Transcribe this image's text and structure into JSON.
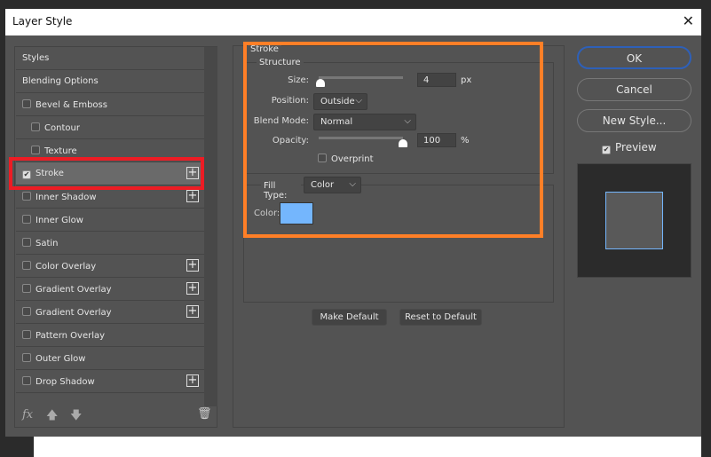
{
  "dialog": {
    "title": "Layer Style",
    "close_icon": "close-icon"
  },
  "sidebar": {
    "items": [
      {
        "label": "Styles",
        "checkbox": false,
        "indent": false,
        "plus": false
      },
      {
        "label": "Blending Options",
        "checkbox": false,
        "indent": false,
        "plus": false
      },
      {
        "label": "Bevel & Emboss",
        "checkbox": true,
        "checked": false,
        "indent": false,
        "plus": false
      },
      {
        "label": "Contour",
        "checkbox": true,
        "checked": false,
        "indent": true,
        "plus": false
      },
      {
        "label": "Texture",
        "checkbox": true,
        "checked": false,
        "indent": true,
        "plus": false
      },
      {
        "label": "Stroke",
        "checkbox": true,
        "checked": true,
        "indent": false,
        "plus": true,
        "selected": true
      },
      {
        "label": "Inner Shadow",
        "checkbox": true,
        "checked": false,
        "indent": false,
        "plus": true
      },
      {
        "label": "Inner Glow",
        "checkbox": true,
        "checked": false,
        "indent": false,
        "plus": false
      },
      {
        "label": "Satin",
        "checkbox": true,
        "checked": false,
        "indent": false,
        "plus": false
      },
      {
        "label": "Color Overlay",
        "checkbox": true,
        "checked": false,
        "indent": false,
        "plus": true
      },
      {
        "label": "Gradient Overlay",
        "checkbox": true,
        "checked": false,
        "indent": false,
        "plus": true
      },
      {
        "label": "Gradient Overlay",
        "checkbox": true,
        "checked": false,
        "indent": false,
        "plus": true
      },
      {
        "label": "Pattern Overlay",
        "checkbox": true,
        "checked": false,
        "indent": false,
        "plus": false
      },
      {
        "label": "Outer Glow",
        "checkbox": true,
        "checked": false,
        "indent": false,
        "plus": false
      },
      {
        "label": "Drop Shadow",
        "checkbox": true,
        "checked": false,
        "indent": false,
        "plus": true
      }
    ],
    "fx_label": "fx"
  },
  "stroke": {
    "title": "Stroke",
    "structure": "Structure",
    "size_label": "Size:",
    "size_value": "4",
    "size_unit": "px",
    "position_label": "Position:",
    "position_value": "Outside",
    "blend_label": "Blend Mode:",
    "blend_value": "Normal",
    "opacity_label": "Opacity:",
    "opacity_value": "100",
    "opacity_unit": "%",
    "overprint_label": "Overprint",
    "filltype_label": "Fill Type:",
    "filltype_value": "Color",
    "color_label": "Color:",
    "color": "#74b6fd",
    "make_default": "Make Default",
    "reset_default": "Reset to Default"
  },
  "actions": {
    "ok": "OK",
    "cancel": "Cancel",
    "new_style": "New Style...",
    "preview": "Preview"
  },
  "highlights": {
    "red": "#ed1c24",
    "orange": "#ff7f27"
  }
}
